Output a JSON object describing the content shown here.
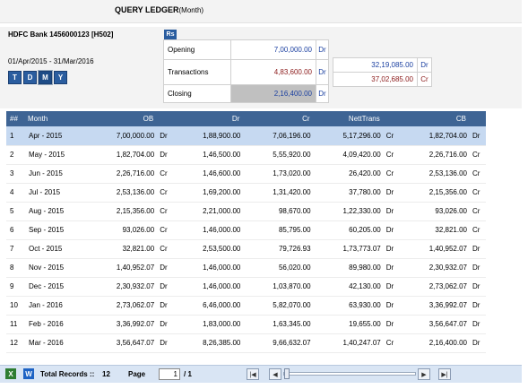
{
  "title": {
    "main": "QUERY LEDGER",
    "sub": "(Month)"
  },
  "account": "HDFC Bank 1456000123 [H502]",
  "period": "01/Apr/2015  -  31/Mar/2016",
  "period_buttons": [
    "T",
    "D",
    "M",
    "Y"
  ],
  "currency_badge": "Rs",
  "summary": {
    "opening": {
      "label": "Opening",
      "value": "7,00,000.00",
      "dc": "Dr"
    },
    "transactions": {
      "label": "Transactions",
      "value": "4,83,600.00",
      "dc": "Dr"
    },
    "closing": {
      "label": "Closing",
      "value": "2,16,400.00",
      "dc": "Dr"
    }
  },
  "transactions_detail": [
    {
      "value": "32,19,085.00",
      "dc": "Dr"
    },
    {
      "value": "37,02,685.00",
      "dc": "Cr"
    }
  ],
  "grid": {
    "headers": [
      "##",
      "Month",
      "OB",
      "Dr",
      "Cr",
      "NettTrans",
      "CB"
    ],
    "rows": [
      {
        "no": "1",
        "month": "Apr - 2015",
        "ob": "7,00,000.00",
        "ob_dc": "Dr",
        "dr": "1,88,900.00",
        "cr": "7,06,196.00",
        "nett": "5,17,296.00",
        "nett_dc": "Cr",
        "cb": "1,82,704.00",
        "cb_dc": "Dr"
      },
      {
        "no": "2",
        "month": "May - 2015",
        "ob": "1,82,704.00",
        "ob_dc": "Dr",
        "dr": "1,46,500.00",
        "cr": "5,55,920.00",
        "nett": "4,09,420.00",
        "nett_dc": "Cr",
        "cb": "2,26,716.00",
        "cb_dc": "Cr"
      },
      {
        "no": "3",
        "month": "Jun - 2015",
        "ob": "2,26,716.00",
        "ob_dc": "Cr",
        "dr": "1,46,600.00",
        "cr": "1,73,020.00",
        "nett": "26,420.00",
        "nett_dc": "Cr",
        "cb": "2,53,136.00",
        "cb_dc": "Cr"
      },
      {
        "no": "4",
        "month": "Jul - 2015",
        "ob": "2,53,136.00",
        "ob_dc": "Cr",
        "dr": "1,69,200.00",
        "cr": "1,31,420.00",
        "nett": "37,780.00",
        "nett_dc": "Dr",
        "cb": "2,15,356.00",
        "cb_dc": "Cr"
      },
      {
        "no": "5",
        "month": "Aug - 2015",
        "ob": "2,15,356.00",
        "ob_dc": "Cr",
        "dr": "2,21,000.00",
        "cr": "98,670.00",
        "nett": "1,22,330.00",
        "nett_dc": "Dr",
        "cb": "93,026.00",
        "cb_dc": "Cr"
      },
      {
        "no": "6",
        "month": "Sep - 2015",
        "ob": "93,026.00",
        "ob_dc": "Cr",
        "dr": "1,46,000.00",
        "cr": "85,795.00",
        "nett": "60,205.00",
        "nett_dc": "Dr",
        "cb": "32,821.00",
        "cb_dc": "Cr"
      },
      {
        "no": "7",
        "month": "Oct - 2015",
        "ob": "32,821.00",
        "ob_dc": "Cr",
        "dr": "2,53,500.00",
        "cr": "79,726.93",
        "nett": "1,73,773.07",
        "nett_dc": "Dr",
        "cb": "1,40,952.07",
        "cb_dc": "Dr"
      },
      {
        "no": "8",
        "month": "Nov - 2015",
        "ob": "1,40,952.07",
        "ob_dc": "Dr",
        "dr": "1,46,000.00",
        "cr": "56,020.00",
        "nett": "89,980.00",
        "nett_dc": "Dr",
        "cb": "2,30,932.07",
        "cb_dc": "Dr"
      },
      {
        "no": "9",
        "month": "Dec - 2015",
        "ob": "2,30,932.07",
        "ob_dc": "Dr",
        "dr": "1,46,000.00",
        "cr": "1,03,870.00",
        "nett": "42,130.00",
        "nett_dc": "Dr",
        "cb": "2,73,062.07",
        "cb_dc": "Dr"
      },
      {
        "no": "10",
        "month": "Jan - 2016",
        "ob": "2,73,062.07",
        "ob_dc": "Dr",
        "dr": "6,46,000.00",
        "cr": "5,82,070.00",
        "nett": "63,930.00",
        "nett_dc": "Dr",
        "cb": "3,36,992.07",
        "cb_dc": "Dr"
      },
      {
        "no": "11",
        "month": "Feb - 2016",
        "ob": "3,36,992.07",
        "ob_dc": "Dr",
        "dr": "1,83,000.00",
        "cr": "1,63,345.00",
        "nett": "19,655.00",
        "nett_dc": "Dr",
        "cb": "3,56,647.07",
        "cb_dc": "Dr"
      },
      {
        "no": "12",
        "month": "Mar - 2016",
        "ob": "3,56,647.07",
        "ob_dc": "Dr",
        "dr": "8,26,385.00",
        "cr": "9,66,632.07",
        "nett": "1,40,247.07",
        "nett_dc": "Cr",
        "cb": "2,16,400.00",
        "cb_dc": "Dr"
      }
    ]
  },
  "footer": {
    "total_label": "Total Records ::",
    "total_count": "12",
    "page_label": "Page",
    "page_value": "1",
    "page_of": "/  1",
    "excel_icon_glyph": "X",
    "word_icon_glyph": "W",
    "nav": {
      "first": "|◀",
      "prev": "◀",
      "next": "▶",
      "last": "▶|"
    }
  },
  "colors": {
    "header_bg": "#3e6494",
    "selected_row": "#c6d9f1",
    "button_blue": "#2a5d9f",
    "debit_blue": "#1a3fa0",
    "credit_red": "#8b1a1a"
  }
}
